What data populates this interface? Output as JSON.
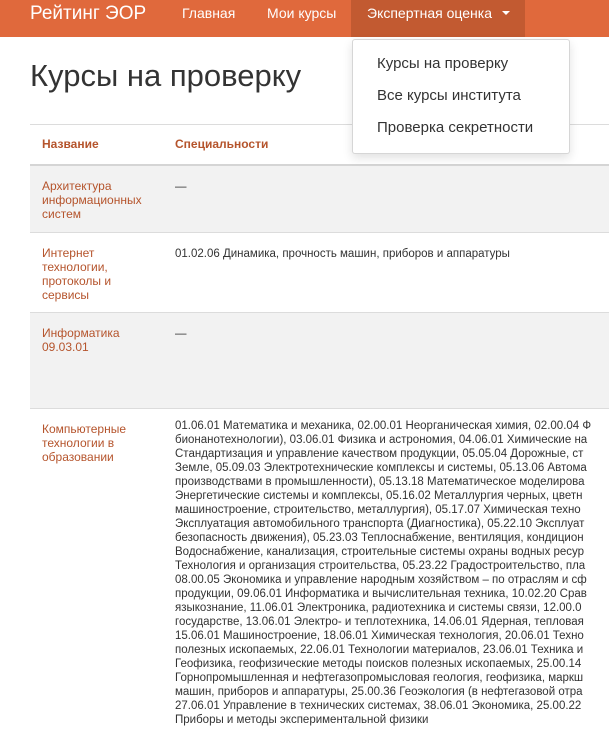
{
  "nav": {
    "brand": "Рейтинг ЭОР",
    "home": "Главная",
    "my_courses": "Мои курсы",
    "expert": "Экспертная оценка"
  },
  "dropdown": [
    "Курсы на проверку",
    "Все курсы института",
    "Проверка секретности"
  ],
  "page_title": "Курсы на проверку",
  "table": {
    "headers": [
      "Название",
      "Специальности"
    ],
    "rows": [
      {
        "name": "Архитектура информационных систем",
        "specs": [
          "—"
        ]
      },
      {
        "name": "Интернет технологии, протоколы и сервисы",
        "specs": [
          "01.02.06 Динамика, прочность машин, приборов и аппаратуры"
        ]
      },
      {
        "name": "Информатика 09.03.01",
        "specs": [
          "—"
        ]
      },
      {
        "name": "Компьютерные технологии в образовании",
        "specs": [
          "01.06.01 Математика и механика, 02.00.01 Неорганическая химия, 02.00.04 Ф",
          "бионанотехнологии), 03.06.01 Физика и астрономия, 04.06.01 Химические на",
          "Стандартизация и управление качеством продукции, 05.05.04 Дорожные, ст",
          "Земле, 05.09.03 Электротехнические комплексы и системы, 05.13.06 Автома",
          "производствами в промышленности), 05.13.18 Математическое моделирова",
          "Энергетические системы и комплексы, 05.16.02 Металлургия черных, цветн",
          "машиностроение, строительство, металлургия), 05.17.07 Химическая техно",
          "Эксплуатация автомобильного транспорта (Диагностика), 05.22.10 Эксплуат",
          "безопасность движения), 05.23.03 Теплоснабжение, вентиляция, кондицион",
          "Водоснабжение, канализация, строительные системы охраны водных ресур",
          "Технология и организация строительства, 05.23.22 Градостроительство, пла",
          "08.00.05 Экономика и управление народным хозяйством – по отраслям и сф",
          "продукции, 09.06.01 Информатика и вычислительная техника, 10.02.20 Срав",
          "языкознание, 11.06.01 Электроника, радиотехника и системы связи, 12.00.0",
          "государстве, 13.06.01 Электро- и теплотехника, 14.06.01 Ядерная, тепловая",
          "15.06.01 Машиностроение, 18.06.01 Химическая технология, 20.06.01 Техно",
          "полезных ископаемых, 22.06.01 Технологии материалов, 23.06.01 Техника и",
          "Геофизика, геофизические методы поисков полезных ископаемых, 25.00.14",
          "Горнопромышленная и нефтегазопромысловая геология, геофизика, маркш",
          "машин, приборов и аппаратуры, 25.00.36 Геоэкология (в нефтегазовой отра",
          "27.06.01 Управление в технических системах, 38.06.01 Экономика, 25.00.22",
          "Приборы и методы экспериментальной физики"
        ]
      }
    ]
  }
}
